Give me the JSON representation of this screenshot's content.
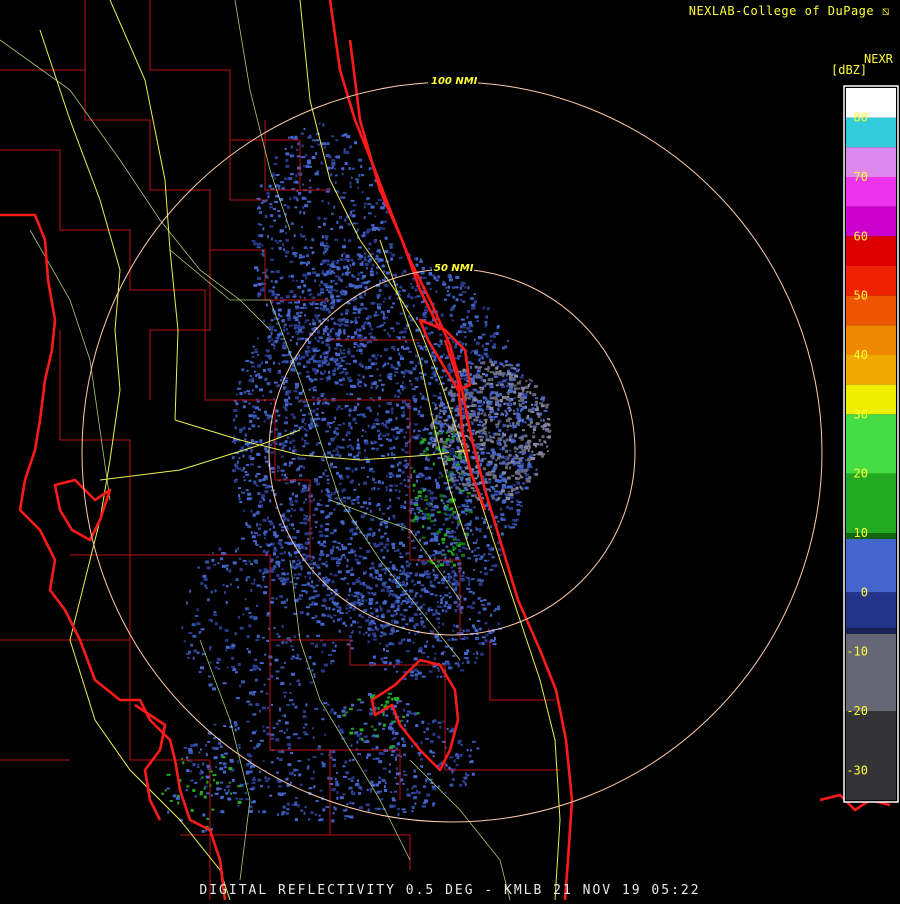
{
  "credit": "NEXLAB-College of DuPage",
  "product": "NEXR",
  "units": "[dBZ]",
  "footer": "DIGITAL REFLECTIVITY 0.5 DEG - KMLB 21 NOV 19 05:22",
  "range_rings": [
    {
      "label": "100 NMI"
    },
    {
      "label": "50 NMI"
    }
  ],
  "colorbar": {
    "ticks": [
      "80",
      "70",
      "60",
      "50",
      "40",
      "30",
      "20",
      "10",
      "0",
      "-10",
      "-20",
      "-30"
    ],
    "stops": [
      {
        "dbz": 85,
        "color": "#ffffff"
      },
      {
        "dbz": 80,
        "color": "#33ccdd"
      },
      {
        "dbz": 75,
        "color": "#dd88ee"
      },
      {
        "dbz": 70,
        "color": "#ee33ee"
      },
      {
        "dbz": 65,
        "color": "#cc00cc"
      },
      {
        "dbz": 60,
        "color": "#dd0000"
      },
      {
        "dbz": 55,
        "color": "#ee2200"
      },
      {
        "dbz": 50,
        "color": "#ee5500"
      },
      {
        "dbz": 45,
        "color": "#ee8800"
      },
      {
        "dbz": 40,
        "color": "#eeaa00"
      },
      {
        "dbz": 35,
        "color": "#eeee00"
      },
      {
        "dbz": 30,
        "color": "#44dd44"
      },
      {
        "dbz": 20,
        "color": "#22aa22"
      },
      {
        "dbz": 10,
        "color": "#116611"
      },
      {
        "dbz": 9,
        "color": "#4466cc"
      },
      {
        "dbz": 0,
        "color": "#223388"
      },
      {
        "dbz": -6,
        "color": "#1a2255"
      },
      {
        "dbz": -7,
        "color": "#666677"
      },
      {
        "dbz": -20,
        "color": "#333338"
      },
      {
        "dbz": -35,
        "color": "#0a0a0a"
      }
    ]
  },
  "colors": {
    "coast": "#ff1a1a",
    "county": "#bb1111",
    "roads": "#eeee55",
    "roads2": "#ccee88",
    "rings": "#ffccaa",
    "echo_light": "#4466cc",
    "echo_dark": "#2a3a8a",
    "echo_gray": "#777788",
    "echo_green": "#22aa22"
  }
}
